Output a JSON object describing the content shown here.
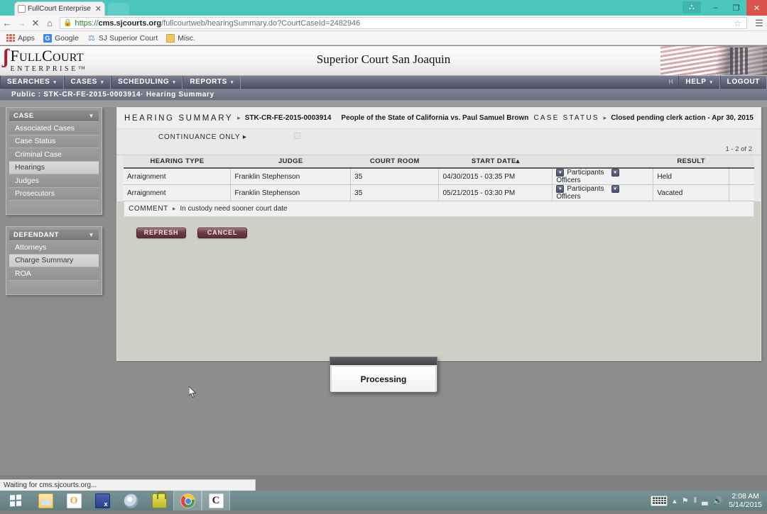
{
  "browser": {
    "tab": {
      "title": "FullCourt Enterprise - Hea",
      "close_label": "✕",
      "favicon": "page-icon"
    },
    "nav": {
      "back": "←",
      "forward": "→",
      "stop": "✕",
      "home": "⌂"
    },
    "address": {
      "scheme": "https://",
      "host": "cms.sjcourts.org",
      "path": "/fullcourtweb/hearingSummary.do?CourtCaseId=2482946",
      "lock_icon": "lock-icon",
      "star_icon": "☆"
    },
    "menu_icon": "☰",
    "window_controls": {
      "profile": "⛬",
      "minimize": "–",
      "maximize": "❐",
      "close": "✕"
    },
    "bookmarks": [
      {
        "label": "Apps",
        "icon": "apps-grid-icon"
      },
      {
        "label": "Google",
        "icon": "google-icon"
      },
      {
        "label": "SJ Superior Court",
        "icon": "scales-icon"
      },
      {
        "label": "Misc.",
        "icon": "folder-icon"
      }
    ]
  },
  "app": {
    "logo": {
      "mark": "ʃ",
      "name_cap_f": "F",
      "name_1": "ULL",
      "name_cap_c": "C",
      "name_2": "OURT",
      "subtitle": "ENTERPRISE™"
    },
    "court_title": "Superior Court San Joaquin",
    "menu": [
      {
        "label": "SEARCHES",
        "caret": "▾"
      },
      {
        "label": "CASES",
        "caret": "▾"
      },
      {
        "label": "SCHEDULING",
        "caret": "▾"
      },
      {
        "label": "REPORTS",
        "caret": "▾"
      }
    ],
    "menu_right": {
      "user_initial": "H",
      "help": "HELP",
      "help_caret": "▾",
      "logout": "LOGOUT"
    },
    "breadcrumb": "Public : STK-CR-FE-2015-0003914· Hearing Summary"
  },
  "sidebar": {
    "panels": [
      {
        "title": "CASE",
        "caret": "▼",
        "items": [
          {
            "label": "Associated Cases",
            "active": false
          },
          {
            "label": "Case Status",
            "active": false
          },
          {
            "label": "Criminal Case",
            "active": false
          },
          {
            "label": "Hearings",
            "active": true
          },
          {
            "label": "Judges",
            "active": false
          },
          {
            "label": "Prosecutors",
            "active": false
          }
        ]
      },
      {
        "title": "DEFENDANT",
        "caret": "▼",
        "items": [
          {
            "label": "Attorneys",
            "active": false
          },
          {
            "label": "Charge Summary",
            "active": true
          },
          {
            "label": "ROA",
            "active": false
          }
        ]
      }
    ]
  },
  "content": {
    "header": {
      "title": "HEARING SUMMARY",
      "arrow": "▸",
      "case_number": "STK-CR-FE-2015-0003914",
      "case_caption": "People of the State of California vs. Paul Samuel Brown",
      "status_label": "CASE STATUS",
      "status_value": "Closed pending clerk action - Apr 30, 2015"
    },
    "subheader": {
      "continuance_only_label": "CONTINUANCE ONLY",
      "continuance_arrow": "▸",
      "paging": "1 - 2 of 2"
    },
    "table": {
      "columns": [
        "HEARING TYPE",
        "JUDGE",
        "COURT ROOM",
        "START DATE▴",
        "",
        "RESULT",
        ""
      ],
      "rows": [
        {
          "hearing_type": "Arraignment",
          "judge": "Franklin Stephenson",
          "court_room": "35",
          "start_date": "04/30/2015 - 03:35 PM",
          "participants_label": "Participants",
          "officers_label": "Officers",
          "result": "Held"
        },
        {
          "hearing_type": "Arraignment",
          "judge": "Franklin Stephenson",
          "court_room": "35",
          "start_date": "05/21/2015 - 03:30 PM",
          "participants_label": "Participants",
          "officers_label": "Officers",
          "result": "Vacated"
        }
      ]
    },
    "comment": {
      "label": "COMMENT",
      "arrow": "▸",
      "value": "In custody need sooner court date"
    },
    "buttons": {
      "refresh": "REFRESH",
      "cancel": "CANCEL"
    }
  },
  "dialog": {
    "message": "Processing"
  },
  "status_bar": {
    "text": "Waiting for cms.sjcourts.org..."
  },
  "taskbar": {
    "start_icon": "windows-logo-icon",
    "apps": [
      {
        "name": "file-explorer-icon"
      },
      {
        "name": "outlook-icon"
      },
      {
        "name": "excel-icon"
      },
      {
        "name": "disc-icon"
      },
      {
        "name": "lock-icon"
      },
      {
        "name": "chrome-icon"
      },
      {
        "name": "citrix-icon"
      }
    ],
    "tray": {
      "keyboard_icon": "keyboard-icon",
      "chevron": "▴",
      "network_icon": "⚑",
      "device_icon": "‖",
      "signal_icon": "▃",
      "volume_icon": "🔊",
      "time": "2:08 AM",
      "date": "5/14/2015"
    }
  },
  "colors": {
    "tab_strip": "#4bc6be",
    "accent_button": "#6e3b44",
    "logo_red": "#a51c2c",
    "menubar": "#5e6378"
  }
}
